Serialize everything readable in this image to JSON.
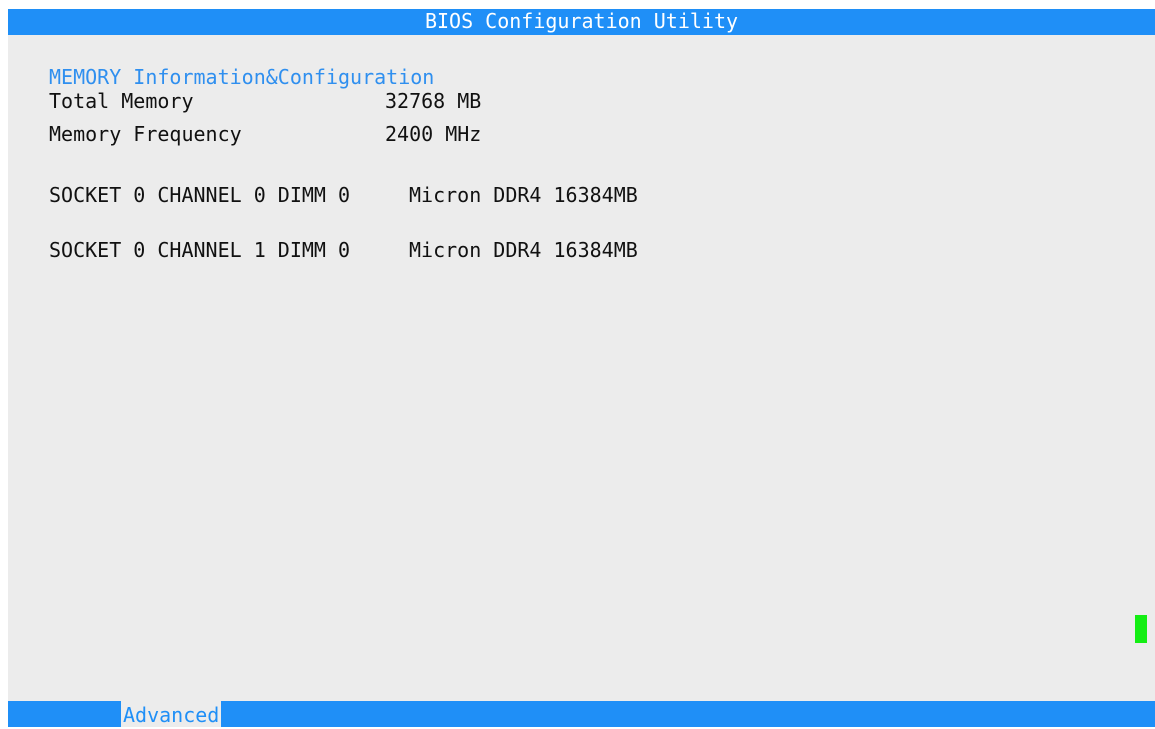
{
  "title_bar": {
    "title": "BIOS Configuration Utility"
  },
  "main": {
    "section_title": "MEMORY Information&Configuration",
    "info_rows": [
      {
        "label": "Total Memory",
        "value": "32768 MB"
      },
      {
        "label": "Memory Frequency",
        "value": "2400 MHz"
      }
    ],
    "dimms": [
      {
        "label": "SOCKET 0 CHANNEL 0 DIMM 0",
        "value": "Micron DDR4 16384MB"
      },
      {
        "label": "SOCKET 0 CHANNEL 1 DIMM 0",
        "value": "Micron DDR4 16384MB"
      }
    ]
  },
  "bottom_bar": {
    "tabs": [
      {
        "label": "Advanced"
      }
    ]
  },
  "colors": {
    "bar": "#1f8ff7",
    "background": "#ececec",
    "section_title": "#2f8fef",
    "cursor": "#14ee14"
  }
}
